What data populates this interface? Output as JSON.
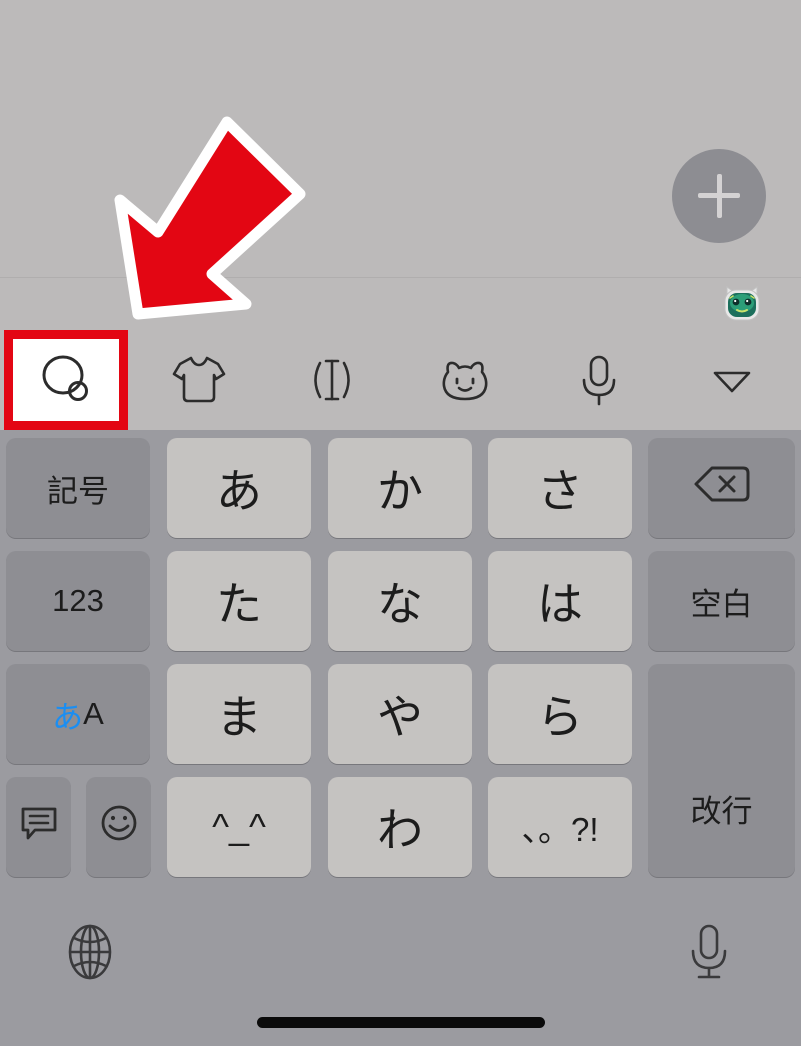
{
  "app": {
    "background_color": "#bcbaba",
    "add_button": {
      "name": "add-button",
      "icon": "plus-icon",
      "label": "+"
    }
  },
  "avatar_strip": {
    "avatar": {
      "name": "character-avatar",
      "icon": "green-cat-avatar-icon",
      "colors": [
        "#2f8f6e",
        "#15423a",
        "#c9e36b",
        "#dcdcdc"
      ]
    }
  },
  "toolbar": {
    "items": [
      {
        "name": "speech-bubble-icon",
        "label": "",
        "highlighted": true
      },
      {
        "name": "tshirt-icon",
        "label": ""
      },
      {
        "name": "text-cursor-brackets-icon",
        "label": ""
      },
      {
        "name": "bear-face-icon",
        "label": ""
      },
      {
        "name": "microphone-icon",
        "label": ""
      },
      {
        "name": "chevron-down-icon",
        "label": ""
      }
    ]
  },
  "annotation": {
    "arrow": {
      "name": "red-arrow-annotation",
      "fill": "#e30613",
      "stroke": "#ffffff",
      "direction": "down-left"
    },
    "highlight": {
      "name": "red-highlight-box",
      "color": "#e30613",
      "fill": "#ffffff",
      "target": "speech-bubble-icon"
    }
  },
  "keyboard": {
    "background_color": "#9b9ba0",
    "char_key_color": "#c5c3c1",
    "func_key_color": "#8e8e93",
    "accent_color": "#1b8ef2",
    "rows": [
      {
        "keys": [
          {
            "name": "key-symbols",
            "label": "記号",
            "type": "func"
          },
          {
            "name": "key-a",
            "label": "あ",
            "type": "char"
          },
          {
            "name": "key-ka",
            "label": "か",
            "type": "char"
          },
          {
            "name": "key-sa",
            "label": "さ",
            "type": "char"
          },
          {
            "name": "key-backspace",
            "label": "",
            "icon": "backspace-icon",
            "type": "func"
          }
        ]
      },
      {
        "keys": [
          {
            "name": "key-123",
            "label": "123",
            "type": "func"
          },
          {
            "name": "key-ta",
            "label": "た",
            "type": "char"
          },
          {
            "name": "key-na",
            "label": "な",
            "type": "char"
          },
          {
            "name": "key-ha",
            "label": "は",
            "type": "char"
          },
          {
            "name": "key-space",
            "label": "空白",
            "type": "func"
          }
        ]
      },
      {
        "keys": [
          {
            "name": "key-input-mode",
            "label_kana": "あ",
            "label_latin": "A",
            "type": "func"
          },
          {
            "name": "key-ma",
            "label": "ま",
            "type": "char"
          },
          {
            "name": "key-ya",
            "label": "や",
            "type": "char"
          },
          {
            "name": "key-ra",
            "label": "ら",
            "type": "char"
          },
          {
            "name": "key-enter",
            "label": "改行",
            "type": "func"
          }
        ]
      },
      {
        "keys": [
          {
            "name": "key-conversion-panel",
            "label": "",
            "icon": "chat-bubble-lines-icon",
            "type": "func"
          },
          {
            "name": "key-emoji",
            "label": "",
            "icon": "smiley-face-icon",
            "type": "func"
          },
          {
            "name": "key-kaomoji",
            "label": "^_^",
            "type": "char"
          },
          {
            "name": "key-wa",
            "label": "わ",
            "type": "char"
          },
          {
            "name": "key-punctuation",
            "label": "、。?!",
            "type": "char"
          }
        ]
      }
    ]
  },
  "bottom_bar": {
    "globe": {
      "name": "globe-key",
      "icon": "globe-icon"
    },
    "mic": {
      "name": "dictation-key",
      "icon": "microphone-icon"
    },
    "home_indicator": {
      "name": "home-indicator",
      "color": "#0b0b0b"
    }
  }
}
